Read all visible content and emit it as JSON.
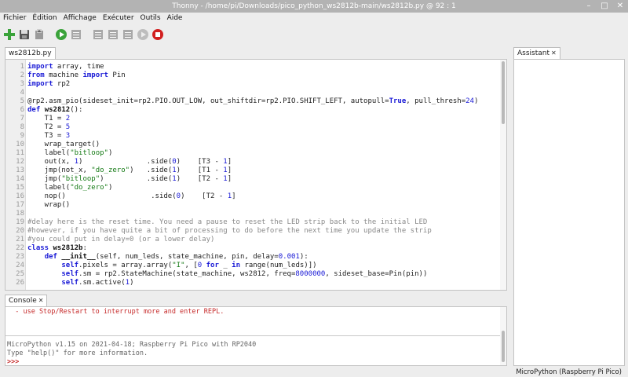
{
  "window": {
    "title": "Thonny  -  /home/pi/Downloads/pico_python_ws2812b-main/ws2812b.py  @  92 : 1",
    "controls": [
      "–",
      "□",
      "✕"
    ]
  },
  "menu": [
    "Fichier",
    "Édition",
    "Affichage",
    "Exécuter",
    "Outils",
    "Aide"
  ],
  "toolbar": {
    "icons": [
      "new-file-icon",
      "open-file-icon",
      "save-file-icon",
      "run-icon",
      "debug-icon",
      "step-over-icon",
      "step-into-icon",
      "step-out-icon",
      "resume-icon",
      "stop-icon"
    ],
    "colors": {
      "green": "#3aa33a",
      "red": "#d11f1f",
      "disabled": "#a8a8a8"
    }
  },
  "editor": {
    "tab_label": "ws2812b.py",
    "tab_close": "✕",
    "lines": [
      {
        "n": "1",
        "html": "<span class=\"kw\">import</span> array, time"
      },
      {
        "n": "2",
        "html": "<span class=\"kw\">from</span> machine <span class=\"kw\">import</span> Pin"
      },
      {
        "n": "3",
        "html": "<span class=\"kw\">import</span> rp2"
      },
      {
        "n": "4",
        "html": ""
      },
      {
        "n": "5",
        "html": "@rp2.asm_pio(sideset_init=rp2.PIO.OUT_LOW, out_shiftdir=rp2.PIO.SHIFT_LEFT, autopull=<span class=\"kw\">True</span>, pull_thresh=<span class=\"num\">24</span>)"
      },
      {
        "n": "6",
        "html": "<span class=\"kw\">def</span> <span class=\"cls\">ws2812</span>():"
      },
      {
        "n": "7",
        "html": "    T1 = <span class=\"num\">2</span>"
      },
      {
        "n": "8",
        "html": "    T2 = <span class=\"num\">5</span>"
      },
      {
        "n": "9",
        "html": "    T3 = <span class=\"num\">3</span>"
      },
      {
        "n": "10",
        "html": "    wrap_target()"
      },
      {
        "n": "11",
        "html": "    label(<span class=\"str\">\"bitloop\"</span>)"
      },
      {
        "n": "12",
        "html": "    out(x, <span class=\"num\">1</span>)               .side(<span class=\"num\">0</span>)    [T3 - <span class=\"num\">1</span>]"
      },
      {
        "n": "13",
        "html": "    jmp(not_x, <span class=\"str\">\"do_zero\"</span>)   .side(<span class=\"num\">1</span>)    [T1 - <span class=\"num\">1</span>]"
      },
      {
        "n": "14",
        "html": "    jmp(<span class=\"str\">\"bitloop\"</span>)          .side(<span class=\"num\">1</span>)    [T2 - <span class=\"num\">1</span>]"
      },
      {
        "n": "15",
        "html": "    label(<span class=\"str\">\"do_zero\"</span>)"
      },
      {
        "n": "16",
        "html": "    nop()                    .side(<span class=\"num\">0</span>)    [T2 - <span class=\"num\">1</span>]"
      },
      {
        "n": "17",
        "html": "    wrap()"
      },
      {
        "n": "18",
        "html": ""
      },
      {
        "n": "19",
        "html": "<span class=\"com\">#delay here is the reset time. You need a pause to reset the LED strip back to the initial LED</span>"
      },
      {
        "n": "20",
        "html": "<span class=\"com\">#however, if you have quite a bit of processing to do before the next time you update the strip</span>"
      },
      {
        "n": "21",
        "html": "<span class=\"com\">#you could put in delay=0 (or a lower delay)</span>"
      },
      {
        "n": "22",
        "html": "<span class=\"kw\">class</span> <span class=\"cls\">ws2812b</span>:"
      },
      {
        "n": "23",
        "html": "    <span class=\"kw\">def</span> <span class=\"cls\">__init__</span>(self, num_leds, state_machine, pin, delay=<span class=\"num\">0.001</span>):"
      },
      {
        "n": "24",
        "html": "        <span class=\"kw\">self</span>.pixels = array.array(<span class=\"str\">\"I\"</span>, [<span class=\"num\">0</span> <span class=\"kw\">for</span> _ <span class=\"kw\">in</span> range(num_leds)])"
      },
      {
        "n": "25",
        "html": "        <span class=\"kw\">self</span>.sm = rp2.StateMachine(state_machine, ws2812, freq=<span class=\"num\">8000000</span>, sideset_base=Pin(pin))"
      },
      {
        "n": "26",
        "html": "        <span class=\"kw\">self</span>.sm.active(<span class=\"num\">1</span>)"
      }
    ]
  },
  "console": {
    "tab_label": "Console",
    "tab_close": "✕",
    "warning": "  - use Stop/Restart to interrupt more and enter REPL.",
    "banner1": "MicroPython v1.15 on 2021-04-18; Raspberry Pi Pico with RP2040",
    "banner2": "Type \"help()\" for more information.",
    "prompt": ">>>"
  },
  "assistant": {
    "tab_label": "Assistant",
    "tab_close": "✕"
  },
  "status": {
    "interpreter": "MicroPython (Raspberry Pi Pico)"
  }
}
